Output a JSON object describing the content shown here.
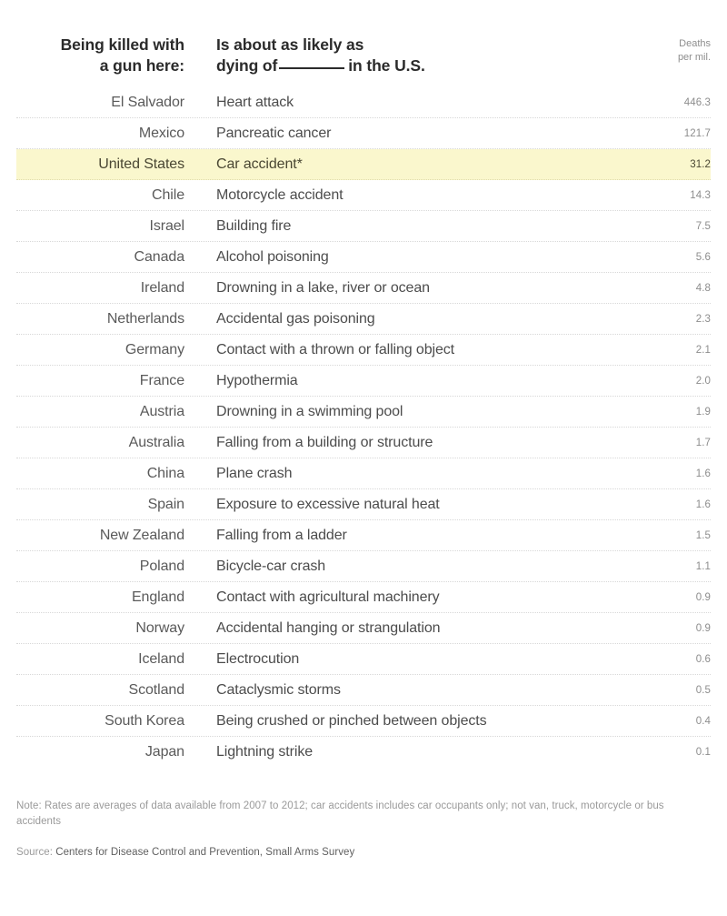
{
  "header": {
    "col_country_line1": "Being killed with",
    "col_country_line2": "a gun here:",
    "col_cause_line1": "Is about as likely as",
    "col_cause_line2_prefix": "dying of",
    "col_cause_line2_suffix": "in the U.S.",
    "col_rate_line1": "Deaths",
    "col_rate_line2": "per mil."
  },
  "chart_data": {
    "type": "table",
    "title": "Being killed with a gun here: Is about as likely as dying of ______ in the U.S.",
    "columns": [
      "Being killed with a gun here:",
      "Is about as likely as dying of ______ in the U.S.",
      "Deaths per mil."
    ],
    "highlighted_row": "United States",
    "highlight_color": "#faf7cd",
    "categories": [
      "El Salvador",
      "Mexico",
      "United States",
      "Chile",
      "Israel",
      "Canada",
      "Ireland",
      "Netherlands",
      "Germany",
      "France",
      "Austria",
      "Australia",
      "China",
      "Spain",
      "New Zealand",
      "Poland",
      "England",
      "Norway",
      "Iceland",
      "Scotland",
      "South Korea",
      "Japan"
    ],
    "values": [
      446.3,
      121.7,
      31.2,
      14.3,
      7.5,
      5.6,
      4.8,
      2.3,
      2.1,
      2.0,
      1.9,
      1.7,
      1.6,
      1.6,
      1.5,
      1.1,
      0.9,
      0.9,
      0.6,
      0.5,
      0.4,
      0.1
    ],
    "causes": [
      "Heart attack",
      "Pancreatic cancer",
      "Car accident*",
      "Motorcycle accident",
      "Building fire",
      "Alcohol poisoning",
      "Drowning in a lake, river or ocean",
      "Accidental gas poisoning",
      "Contact with a thrown or falling object",
      "Hypothermia",
      "Drowning in a swimming pool",
      "Falling from a building or structure",
      "Plane crash",
      "Exposure to excessive natural heat",
      "Falling from a ladder",
      "Bicycle-car crash",
      "Contact with agricultural machinery",
      "Accidental hanging or strangulation",
      "Electrocution",
      "Cataclysmic storms",
      "Being crushed or pinched between objects",
      "Lightning strike"
    ],
    "ylabel": "Deaths per mil.",
    "xlabel": ""
  },
  "rows": [
    {
      "country": "El Salvador",
      "cause": "Heart attack",
      "rate": "446.3",
      "highlight": false
    },
    {
      "country": "Mexico",
      "cause": "Pancreatic cancer",
      "rate": "121.7",
      "highlight": false
    },
    {
      "country": "United States",
      "cause": "Car accident*",
      "rate": "31.2",
      "highlight": true
    },
    {
      "country": "Chile",
      "cause": "Motorcycle accident",
      "rate": "14.3",
      "highlight": false
    },
    {
      "country": "Israel",
      "cause": "Building fire",
      "rate": "7.5",
      "highlight": false
    },
    {
      "country": "Canada",
      "cause": "Alcohol poisoning",
      "rate": "5.6",
      "highlight": false
    },
    {
      "country": "Ireland",
      "cause": "Drowning in a lake, river or ocean",
      "rate": "4.8",
      "highlight": false
    },
    {
      "country": "Netherlands",
      "cause": "Accidental gas poisoning",
      "rate": "2.3",
      "highlight": false
    },
    {
      "country": "Germany",
      "cause": "Contact with a thrown or falling object",
      "rate": "2.1",
      "highlight": false
    },
    {
      "country": "France",
      "cause": "Hypothermia",
      "rate": "2.0",
      "highlight": false
    },
    {
      "country": "Austria",
      "cause": "Drowning in a swimming pool",
      "rate": "1.9",
      "highlight": false
    },
    {
      "country": "Australia",
      "cause": "Falling from a building or structure",
      "rate": "1.7",
      "highlight": false
    },
    {
      "country": "China",
      "cause": "Plane crash",
      "rate": "1.6",
      "highlight": false
    },
    {
      "country": "Spain",
      "cause": "Exposure to excessive natural heat",
      "rate": "1.6",
      "highlight": false
    },
    {
      "country": "New Zealand",
      "cause": "Falling from a ladder",
      "rate": "1.5",
      "highlight": false
    },
    {
      "country": "Poland",
      "cause": "Bicycle-car crash",
      "rate": "1.1",
      "highlight": false
    },
    {
      "country": "England",
      "cause": "Contact with agricultural machinery",
      "rate": "0.9",
      "highlight": false
    },
    {
      "country": "Norway",
      "cause": "Accidental hanging or strangulation",
      "rate": "0.9",
      "highlight": false
    },
    {
      "country": "Iceland",
      "cause": "Electrocution",
      "rate": "0.6",
      "highlight": false
    },
    {
      "country": "Scotland",
      "cause": "Cataclysmic storms",
      "rate": "0.5",
      "highlight": false
    },
    {
      "country": "South Korea",
      "cause": "Being crushed or pinched between objects",
      "rate": "0.4",
      "highlight": false
    },
    {
      "country": "Japan",
      "cause": "Lightning strike",
      "rate": "0.1",
      "highlight": false
    }
  ],
  "footnotes": {
    "note": "Note: Rates are averages of data available from 2007 to 2012; car accidents includes car occupants only; not van, truck, motorcycle or bus accidents",
    "source_label": "Source:",
    "source_credit": "Centers for Disease Control and Prevention, Small Arms Survey"
  }
}
